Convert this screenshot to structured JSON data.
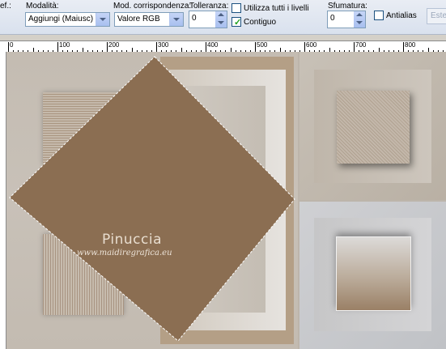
{
  "toolbar": {
    "ref_label": "ef.:",
    "mode": {
      "label": "Modalità:",
      "value": "Aggiungi (Maiusc)"
    },
    "match_mode": {
      "label": "Mod. corrispondenza:",
      "value": "Valore RGB"
    },
    "tolerance": {
      "label": "Tolleranza:",
      "value": "0"
    },
    "use_all_layers": {
      "label": "Utilizza tutti i livelli",
      "checked": false
    },
    "contiguous": {
      "label": "Contiguo",
      "checked": true
    },
    "feather": {
      "label": "Sfumatura:",
      "value": "0"
    },
    "antialias": {
      "label": "Antialias",
      "checked": false
    },
    "outside_button": "Ester"
  },
  "ruler": {
    "labels": [
      "0",
      "100",
      "200",
      "300",
      "400",
      "500",
      "600",
      "700",
      "800"
    ]
  },
  "canvas": {
    "colors": {
      "background": "#bdb5ab",
      "diamond": "#8b6e52",
      "panel_light": "#d3d1cd"
    },
    "watermark": {
      "title": "Pinuccia",
      "url": "www.maidiregrafica.eu"
    }
  }
}
